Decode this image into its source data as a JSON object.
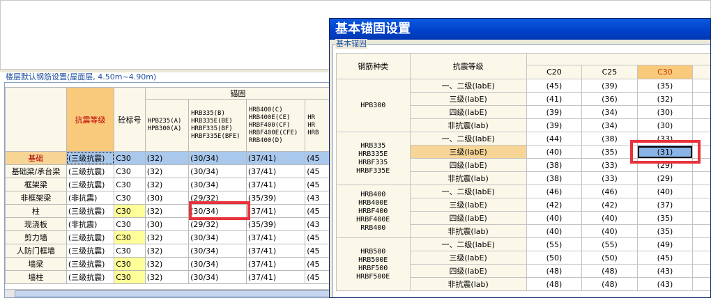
{
  "left_panel": {
    "title": "楼层默认钢筋设置(屋面层, 4.50m~4.90m)",
    "header_group": "锚固",
    "col_seismic": "抗震等级",
    "col_concrete": "砼标号",
    "steel_cols": [
      "HPB235(A)\nHPB300(A)",
      "HRB335(B)\nHRB335E(BE)\nHRBF335(BF)\nHRBF335E(BFE)",
      "HRB400(C)\nHRB400E(CE)\nHRBF400(CF)\nHRBF400E(CFE)\nRRB400(D)",
      "HR\nHR\nHRB"
    ],
    "rows": [
      {
        "name": "基础",
        "seismic": "(三级抗震)",
        "concrete": "C30",
        "v1": "(32)",
        "v2": "(30/34)",
        "v3": "(37/41)",
        "v4": "(45"
      },
      {
        "name": "基础梁/承台梁",
        "seismic": "(三级抗震)",
        "concrete": "C30",
        "v1": "(32)",
        "v2": "(30/34)",
        "v3": "(37/41)",
        "v4": "(45"
      },
      {
        "name": "框架梁",
        "seismic": "(三级抗震)",
        "concrete": "C30",
        "v1": "(32)",
        "v2": "(30/34)",
        "v3": "(37/41)",
        "v4": "(45"
      },
      {
        "name": "非框架梁",
        "seismic": "(非抗震)",
        "concrete": "C30",
        "v1": "(30)",
        "v2": "(29/32)",
        "v3": "(35/39)",
        "v4": "(43"
      },
      {
        "name": "柱",
        "seismic": "(三级抗震)",
        "concrete": "C30",
        "v1": "(32)",
        "v2": "(30/34)",
        "v3": "(37/41)",
        "v4": "(45"
      },
      {
        "name": "现浇板",
        "seismic": "(非抗震)",
        "concrete": "C30",
        "v1": "(30)",
        "v2": "(29/32)",
        "v3": "(35/39)",
        "v4": "(43"
      },
      {
        "name": "剪力墙",
        "seismic": "(三级抗震)",
        "concrete": "C30",
        "v1": "(32)",
        "v2": "(30/34)",
        "v3": "(37/41)",
        "v4": "(45"
      },
      {
        "name": "人防门框墙",
        "seismic": "(三级抗震)",
        "concrete": "C30",
        "v1": "(32)",
        "v2": "(30/34)",
        "v3": "(37/41)",
        "v4": "(45"
      },
      {
        "name": "墙梁",
        "seismic": "(三级抗震)",
        "concrete": "C30",
        "v1": "(32)",
        "v2": "(30/34)",
        "v3": "(37/41)",
        "v4": "(45"
      },
      {
        "name": "墙柱",
        "seismic": "(三级抗震)",
        "concrete": "C30",
        "v1": "(32)",
        "v2": "(30/34)",
        "v3": "(37/41)",
        "v4": "(45"
      }
    ]
  },
  "dialog": {
    "title": "基本锚固设置",
    "group_label": "基本锚固",
    "col_steel": "钢筋种类",
    "col_seismic": "抗震等级",
    "concrete_cols": [
      "C20",
      "C25",
      "C30"
    ],
    "groups": [
      {
        "steel": "HPB300",
        "rows": [
          {
            "level": "一、二级(labE)",
            "c20": "(45)",
            "c25": "(39)",
            "c30": "(35)"
          },
          {
            "level": "三级(labE)",
            "c20": "(41)",
            "c25": "(36)",
            "c30": "(32)"
          },
          {
            "level": "四级(labE)",
            "c20": "(39)",
            "c25": "(34)",
            "c30": "(30)"
          },
          {
            "level": "非抗震(lab)",
            "c20": "(39)",
            "c25": "(34)",
            "c30": "(30)"
          }
        ]
      },
      {
        "steel": "HRB335\nHRB335E\nHRBF335\nHRBF335E",
        "rows": [
          {
            "level": "一、二级(labE)",
            "c20": "(44)",
            "c25": "(38)",
            "c30": "(33)"
          },
          {
            "level": "三级(labE)",
            "c20": "(40)",
            "c25": "(35)",
            "c30": "(31)"
          },
          {
            "level": "四级(labE)",
            "c20": "(38)",
            "c25": "(33)",
            "c30": "(29)"
          },
          {
            "level": "非抗震(lab)",
            "c20": "(38)",
            "c25": "(33)",
            "c30": "(29)"
          }
        ]
      },
      {
        "steel": "HRB400\nHRB400E\nHRBF400\nHRBF400E\nRRB400",
        "rows": [
          {
            "level": "一、二级(labE)",
            "c20": "(46)",
            "c25": "(46)",
            "c30": "(40)"
          },
          {
            "level": "三级(labE)",
            "c20": "(42)",
            "c25": "(42)",
            "c30": "(37)"
          },
          {
            "level": "四级(labE)",
            "c20": "(40)",
            "c25": "(40)",
            "c30": "(35)"
          },
          {
            "level": "非抗震(lab)",
            "c20": "(40)",
            "c25": "(40)",
            "c30": "(35)"
          }
        ]
      },
      {
        "steel": "HRB500\nHRB500E\nHRBF500\nHRBF500E",
        "rows": [
          {
            "level": "一、二级(labE)",
            "c20": "(55)",
            "c25": "(55)",
            "c30": "(49)"
          },
          {
            "level": "三级(labE)",
            "c20": "(50)",
            "c25": "(50)",
            "c30": "(45)"
          },
          {
            "level": "四级(labE)",
            "c20": "(48)",
            "c25": "(48)",
            "c30": "(43)"
          },
          {
            "level": "非抗震(lab)",
            "c20": "(48)",
            "c25": "(48)",
            "c30": "(43)"
          }
        ]
      }
    ]
  },
  "colors": {
    "highlight_box": "#e8323c",
    "selection": "#a9c8ec",
    "header_orange": "#f9c97c",
    "title_bar": "#0a5ae0"
  }
}
